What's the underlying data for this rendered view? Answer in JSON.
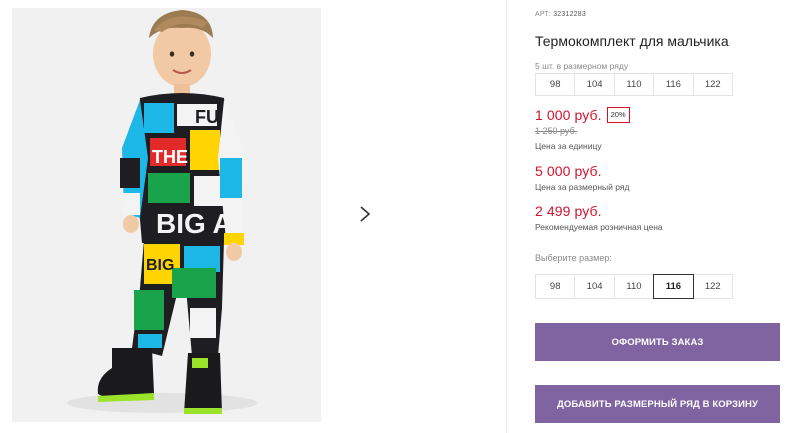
{
  "product": {
    "article_label": "АРТ:",
    "article_number": "32312283",
    "title": "Термокомплект для мальчика"
  },
  "size_run": {
    "label": "5 шт. в размерном ряду",
    "sizes": [
      "98",
      "104",
      "110",
      "116",
      "122"
    ]
  },
  "pricing": {
    "unit_price": "1 000 руб.",
    "discount_badge": "20%",
    "old_price": "1 250 руб.",
    "unit_price_note": "Цена за единицу",
    "run_price": "5 000 руб.",
    "run_price_note": "Цена за размерный ряд",
    "retail_price": "2 499 руб.",
    "retail_price_note": "Рекомендуемая розничная цена",
    "accent_color": "#d0142b"
  },
  "size_picker": {
    "label": "Выберите размер:",
    "options": [
      "98",
      "104",
      "110",
      "116",
      "122"
    ],
    "selected": "116"
  },
  "actions": {
    "order_label": "ОФОРМИТЬ ЗАКАЗ",
    "add_run_label": "ДОБАВИТЬ РАЗМЕРНЫЙ РЯД В КОРЗИНУ",
    "button_color": "#8064a2"
  },
  "gallery": {
    "next_icon": "chevron-right-icon"
  }
}
